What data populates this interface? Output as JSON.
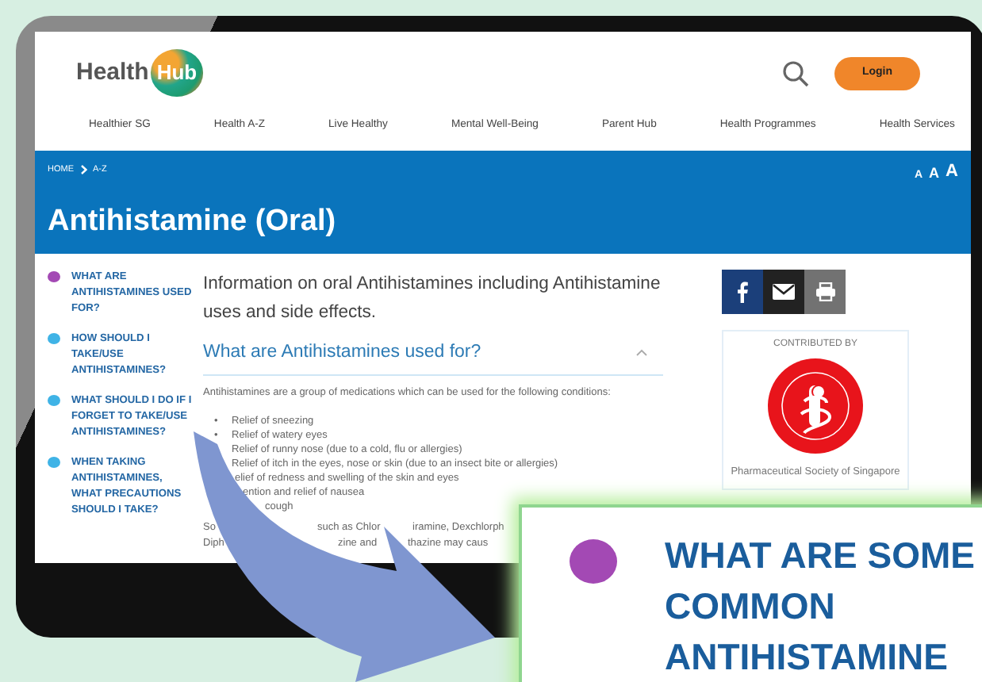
{
  "header": {
    "logo_word": "Health",
    "logo_badge": "Hub",
    "login": "Login"
  },
  "nav": [
    "Healthier SG",
    "Health A-Z",
    "Live Healthy",
    "Mental Well-Being",
    "Parent Hub",
    "Health Programmes",
    "Health Services"
  ],
  "banner": {
    "breadcrumb": [
      "HOME",
      "A-Z"
    ],
    "text_sizes": [
      "A",
      "A",
      "A"
    ],
    "title": "Antihistamine (Oral)"
  },
  "toc": [
    {
      "label": "WHAT ARE ANTIHISTAMINES USED FOR?",
      "color": "#a349b4"
    },
    {
      "label": "HOW SHOULD I TAKE/USE ANTIHISTAMINES?",
      "color": "#3fb3e6"
    },
    {
      "label": "WHAT SHOULD I DO IF I FORGET TO TAKE/USE ANTIHISTAMINES?",
      "color": "#3fb3e6"
    },
    {
      "label": "WHEN TAKING ANTIHISTAMINES, WHAT PRECAUTIONS SHOULD I TAKE?",
      "color": "#3fb3e6"
    }
  ],
  "intro": "Information on oral Antihistamines including Antihistamine uses and side effects.",
  "section": {
    "heading": "What are Antihistamines used for?",
    "expanded": true,
    "bullet": "•",
    "body": "Antihistamines are a group of medications which can be used for the following conditions:",
    "items": [
      "Relief of sneezing",
      "Relief of watery eyes",
      "Relief of runny nose (due to a cold, flu or allergies)",
      "Relief of itch in the eyes, nose or skin (due to an insect bite or allergies)",
      "elief of redness and swelling of the skin and eyes",
      "ention and relief of nausea",
      "cough"
    ],
    "paragraph_lines": [
      [
        "So",
        "such as Chlor",
        "iramine, Dexchlorph"
      ],
      [
        "Diph",
        "zine and",
        "thazine may caus"
      ]
    ]
  },
  "aside": {
    "contributed_label": "CONTRIBUTED BY",
    "contributor": "Pharmaceutical Society of Singapore"
  },
  "callout": {
    "text": "WHAT ARE SOME COMMON ANTIHISTAMINE"
  }
}
